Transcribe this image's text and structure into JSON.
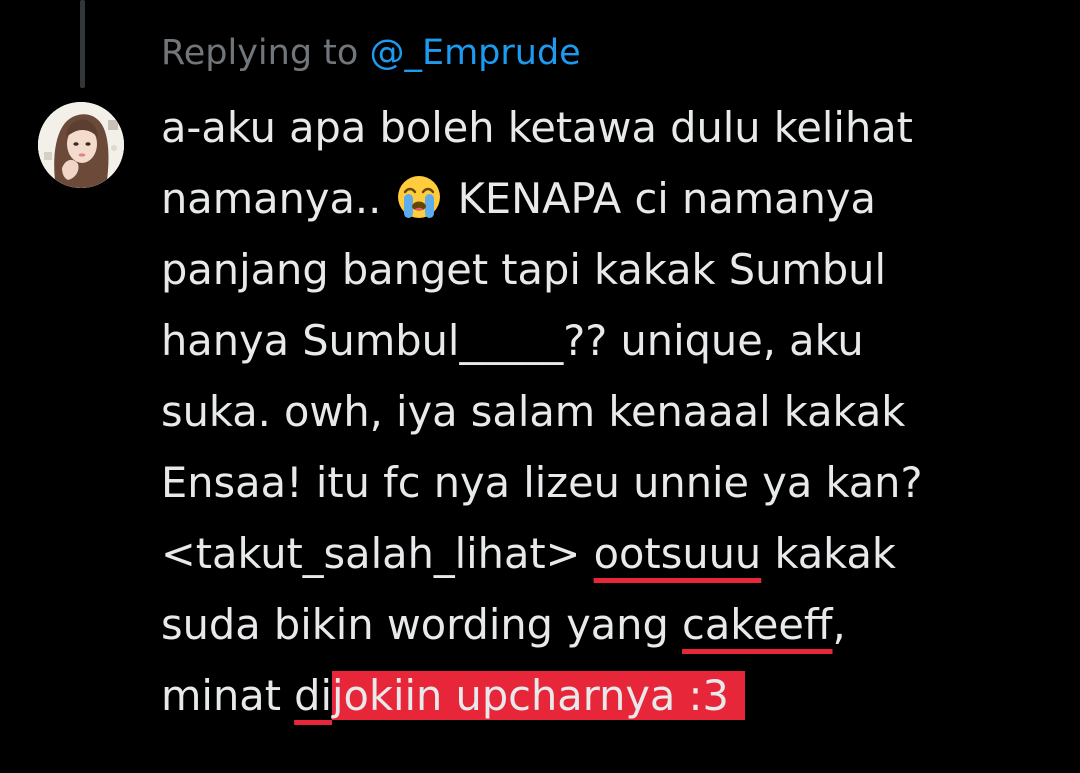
{
  "reply": {
    "prefix": "Replying to",
    "handle": "@_Emprude"
  },
  "avatar": {
    "name": "user-avatar"
  },
  "tweet": {
    "line1": "a-aku apa boleh ketawa dulu kelihat",
    "line2_a": "namanya.. ",
    "emoji": "loudly-crying-face-icon",
    "line2_b": " KENAPA ci namanya",
    "line3": "panjang banget tapi kakak Sumbul",
    "line4": "hanya Sumbul_____?? unique, aku",
    "line5": "suka. owh, iya salam kenaaal kakak",
    "line6": "Ensaa! itu fc nya lizeu unnie ya kan?",
    "line7_a": "<takut_salah_lihat> ",
    "line7_ul": "ootsuuu",
    "line7_b": " kakak",
    "line8_a": "suda bikin wording yang ",
    "line8_ul": "cakeeff",
    "line8_b": ",",
    "line9_a": "minat ",
    "line9_ul": "di",
    "line9_hl": "jokiin upcharnya :3"
  },
  "colors": {
    "background": "#000000",
    "text": "#e7e9ea",
    "muted": "#71767b",
    "link": "#1d9bf0",
    "markup_red": "#e8263a"
  }
}
